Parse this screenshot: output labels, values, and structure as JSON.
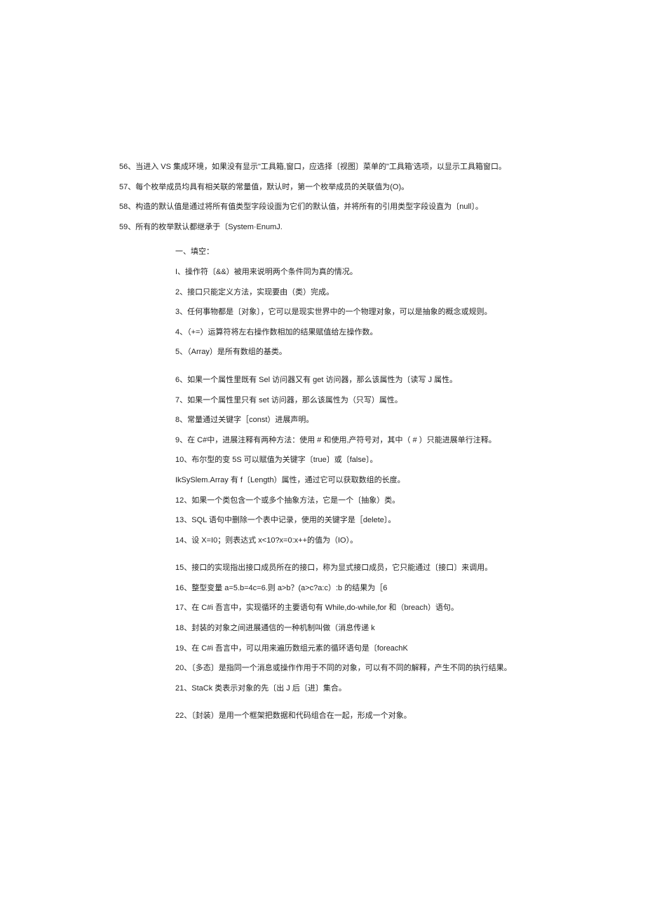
{
  "outer_items": [
    "56、当进入 VS 集成环境，如果没有显示\"工具箱,窗口，应选择〔视图〕菜单的\"工具箱'选项，以显示工具箱窗口。",
    "57、每个枚举成员均具有相关联的常量值，默认时，第一个枚举成员的关联值为(O)。",
    "58、构造的默认值是通过将所有值类型字段设面为它们的默认值，并将所有的引用类型字段设直为〔null〕。",
    "59、所有的枚举默认都继承于〔System·EnumJ."
  ],
  "section_header": "一、填空：",
  "inner_items": [
    {
      "text": "I、操作符〔&&）被用来说明两个条件同为真的情况。",
      "gap": false
    },
    {
      "text": "2、接口只能定义方法，实现要由（类）完成。",
      "gap": false
    },
    {
      "text": "3、任何事物都是〔对象〕，它可以是现实世界中的一个物理对象，可以是抽象的概念或规则。",
      "gap": false
    },
    {
      "text": "4、（+=）运算符将左右操作数相加的结果赋值给左操作数。",
      "gap": false
    },
    {
      "text": "5、（Array）是所有数组的基类。",
      "gap": false
    },
    {
      "text": "6、如果一个属性里既有 Sel 访问器又有 get 访问器，那么该属性为〔读写 J 属性。",
      "gap": true
    },
    {
      "text": "7、如果一个属性里只有 set 访问器，那么该属性为（只写）属性。",
      "gap": false
    },
    {
      "text": "8、常量通过关键字［const）进展声明。",
      "gap": false
    },
    {
      "text": "9、在 C#中，进展注释有两种方法：使用 # 和使用,产符号对，其中（ # ）只能进展单行注释。",
      "gap": false
    },
    {
      "text": "10、布尔型的变 5S 可以赋值为关键字〔true〕或〔false〕。",
      "gap": false
    },
    {
      "text": "IkSySlem.Array 有 f〔Length）属性，通过它可以获取数组的长度。",
      "gap": false
    },
    {
      "text": "12、如果一个类包含一个或多个抽象方法，它是一个〔抽象）类。",
      "gap": false
    },
    {
      "text": "13、SQL 语句中删除一个表中记录，使用的关键字是［delete〕。",
      "gap": false
    },
    {
      "text": "14、设 X=I0；则表达式 x<10?x=0:x++的值为（IO）。",
      "gap": false
    },
    {
      "text": "15、接口的实现指出接口成员所在的接口，称为显式接口成员，它只能通过〔接口〕来调用。",
      "gap": true
    },
    {
      "text": "16、整型变量 a=5.b=4c=6.则 a>b？(a>c?a:c）:b 的结果为［6",
      "gap": false
    },
    {
      "text": "17、在 C#i 吾言中，实现循环的主要语句有 While,do-while,for 和（breach）语句。",
      "gap": false
    },
    {
      "text": "18、封装的对象之间进展通信的一种机制叫做（消息传递 k",
      "gap": false
    },
    {
      "text": "19、在 C#i 吾言中，可以用来遍历数组元素的循环语句是〔foreachK",
      "gap": false
    },
    {
      "text": "20、〔多态〕是指同一个消息或操作作用于不同的对象，可以有不同的解释，产生不同的执行结果。",
      "gap": false
    },
    {
      "text": "21、StaCk 类表示对象的先〔出 J 后〔进〕集合。",
      "gap": false
    },
    {
      "text": "22、〔封装）是用一个框架把数据和代码组合在一起，形成一个对象。",
      "gap": true
    }
  ]
}
